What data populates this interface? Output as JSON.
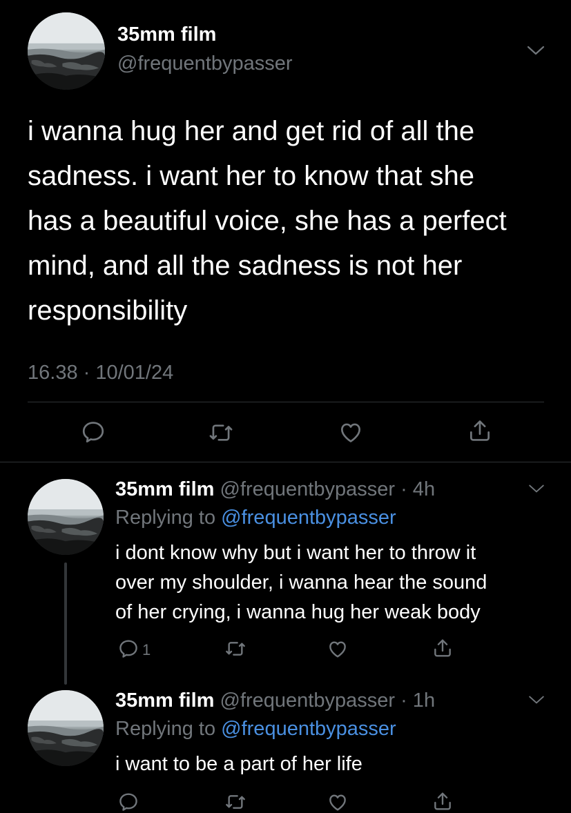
{
  "main_tweet": {
    "display_name": "35mm film",
    "handle": "@frequentbypasser",
    "text_lines": [
      "i wanna hug her and get rid of all the",
      "sadness. i want her to know that she",
      "has a beautiful voice, she has a perfect",
      "mind, and all the sadness is not her",
      "responsibility"
    ],
    "timestamp": "16.38 · 10/01/24"
  },
  "replies": [
    {
      "display_name": "35mm film",
      "handle_time": "@frequentbypasser · 4h",
      "replying_prefix": "Replying to",
      "replying_handle": "@frequentbypasser",
      "text_lines": [
        "i dont know why but i want her to throw it",
        "over my shoulder, i wanna hear the sound",
        "of her crying, i wanna hug her weak body"
      ],
      "reply_count": "1"
    },
    {
      "display_name": "35mm film",
      "handle_time": "@frequentbypasser · 1h",
      "replying_prefix": "Replying to",
      "replying_handle": "@frequentbypasser",
      "text_lines": [
        "i want to be a part of her life"
      ],
      "reply_count": ""
    }
  ],
  "colors": {
    "background": "#000000",
    "text": "#ffffff",
    "muted": "#71767b",
    "link": "#4a90e2",
    "divider": "#2f3336"
  },
  "icons": {
    "reply": "reply-icon",
    "retweet": "retweet-icon",
    "like": "heart-icon",
    "share": "share-icon",
    "more": "chevron-down-icon"
  }
}
